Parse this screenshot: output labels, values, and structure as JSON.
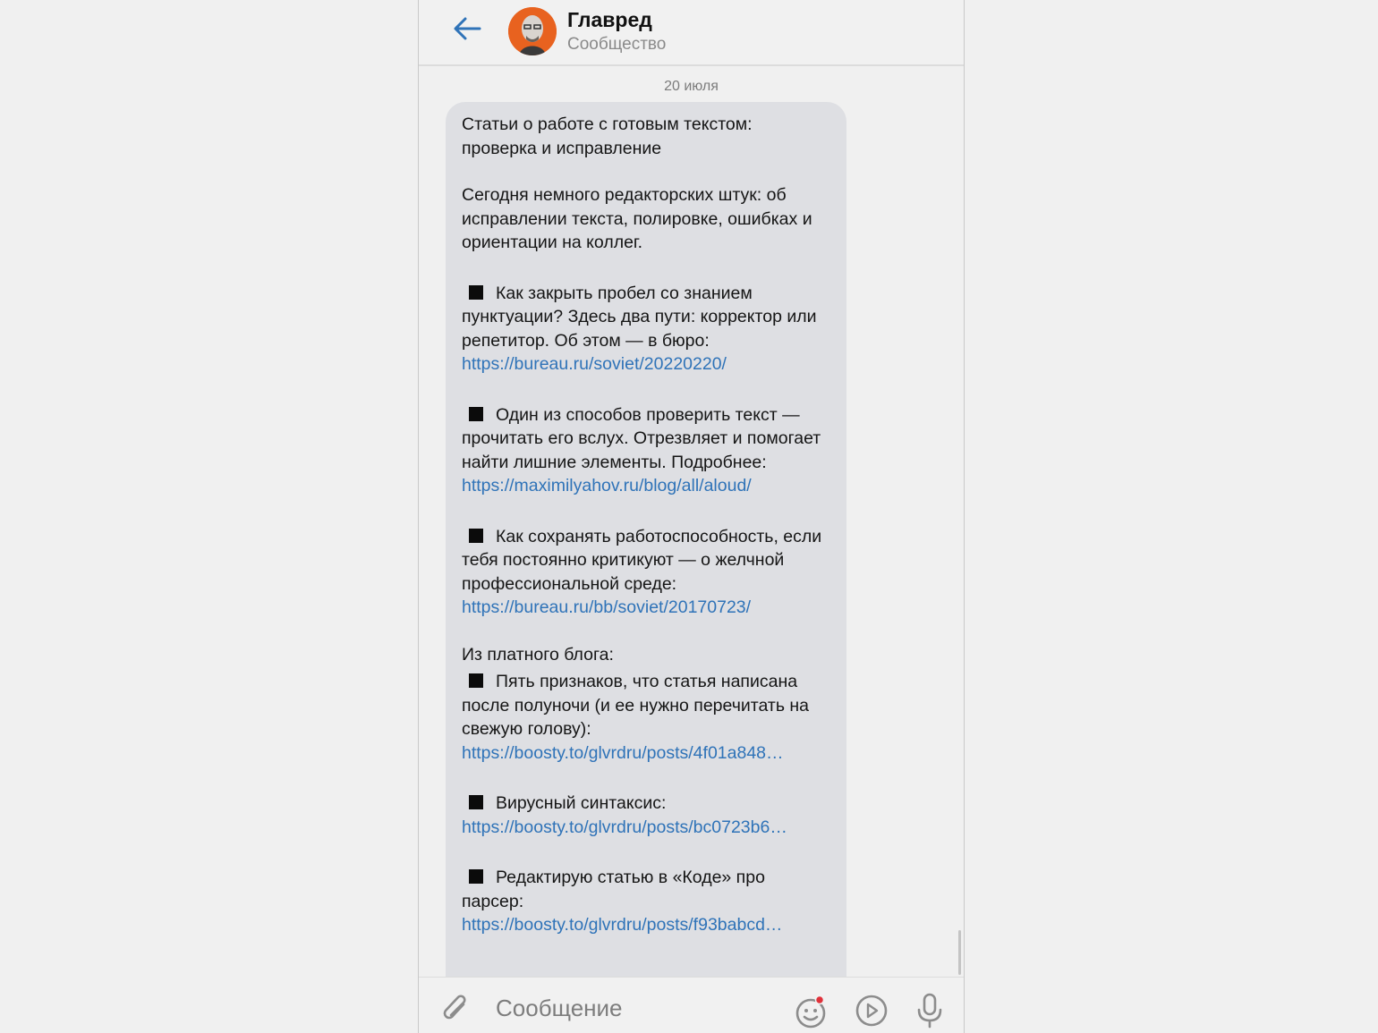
{
  "header": {
    "title": "Главред",
    "subtitle": "Сообщество"
  },
  "date_separator": "20 июля",
  "message": {
    "title_line1": "Статьи о работе с готовым текстом:",
    "title_line2": "проверка и исправление",
    "intro": "Сегодня немного редакторских штук: об исправлении текста, полировке, ошибках и ориентации на коллег.",
    "items": [
      {
        "text": "Как закрыть пробел со знанием пунктуации? Здесь два пути: корректор или репетитор. Об этом — в бюро:",
        "link": "https://bureau.ru/soviet/20220220/"
      },
      {
        "text": "Один из способов проверить текст — прочитать его вслух. Отрезвляет и помогает найти лишние элементы. Подробнее:",
        "link": "https://maximilyahov.ru/blog/all/aloud/"
      },
      {
        "text": "Как сохранять работоспособность, если тебя постоянно критикуют — о желчной профессиональной среде:",
        "link": "https://bureau.ru/bb/soviet/20170723/"
      }
    ],
    "paid_heading": "Из платного блога:",
    "paid_items": [
      {
        "text": "Пять признаков, что статья написана после полуночи (и ее нужно перечитать на свежую голову):",
        "link": "https://boosty.to/glvrdru/posts/4f01a848…"
      },
      {
        "text": "Вирусный синтаксис:",
        "link": "https://boosty.to/glvrdru/posts/bc0723b6…"
      },
      {
        "text": "Редактирую статью в «Коде» про парсер:",
        "link": "https://boosty.to/glvrdru/posts/f93babcd…"
      }
    ]
  },
  "composer": {
    "placeholder": "Сообщение"
  },
  "icons": {
    "back": "back-arrow-icon",
    "attach": "paperclip-icon",
    "emoji": "smile-icon",
    "video": "play-circle-icon",
    "voice": "microphone-icon"
  },
  "colors": {
    "accent": "#2f73b8",
    "avatar_bg": "#e8621f",
    "bubble_bg": "#dedfe3",
    "badge_dot": "#e0313a"
  }
}
